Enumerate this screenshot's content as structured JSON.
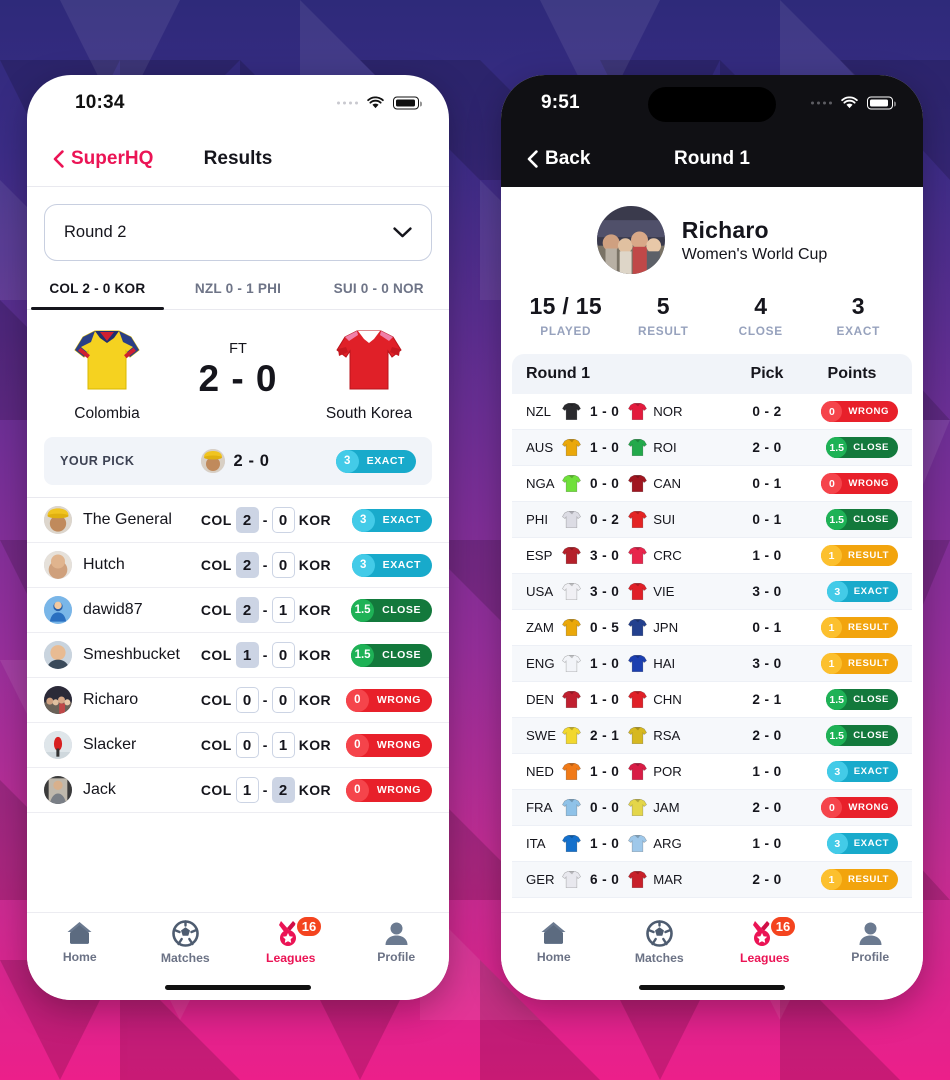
{
  "background": {
    "top_color": "#2e2a7a",
    "bottom_color": "#ec1f8a"
  },
  "left_phone": {
    "status": {
      "time": "10:34",
      "wifi_icon": "wifi-icon",
      "battery_icon": "battery-icon",
      "cellular_icon": "cellular-dots-icon"
    },
    "nav": {
      "back_label": "SuperHQ",
      "back_icon": "chevron-left-icon",
      "title": "Results",
      "accent": "#eb1455"
    },
    "round_select": {
      "value": "Round 2",
      "chevron_icon": "chevron-down-icon"
    },
    "match_tabs": [
      {
        "label": "COL 2 - 0 KOR",
        "active": true
      },
      {
        "label": "NZL 0 - 1 PHI",
        "active": false
      },
      {
        "label": "SUI 0 - 0 NOR",
        "active": false
      }
    ],
    "scoreboard": {
      "home": {
        "name": "Colombia",
        "shirt_icon": "shirt-colombia-icon",
        "shirt_color": "#f5d220"
      },
      "away": {
        "name": "South Korea",
        "shirt_icon": "shirt-south-korea-icon",
        "shirt_color": "#e02028"
      },
      "status": "FT",
      "score": "2 - 0"
    },
    "your_pick": {
      "label": "YOUR PICK",
      "avatar_icon": "avatar-the-general-icon",
      "score": "2 - 0",
      "pill": {
        "points": "3",
        "label": "EXACT",
        "kind": "exact"
      }
    },
    "picks": [
      {
        "name": "The General",
        "avatar_icon": "avatar-the-general-icon",
        "home_abbr": "COL",
        "home": "2",
        "away": "0",
        "away_abbr": "KOR",
        "pill": {
          "points": "3",
          "label": "EXACT",
          "kind": "exact"
        }
      },
      {
        "name": "Hutch",
        "avatar_icon": "avatar-hutch-icon",
        "home_abbr": "COL",
        "home": "2",
        "away": "0",
        "away_abbr": "KOR",
        "pill": {
          "points": "3",
          "label": "EXACT",
          "kind": "exact"
        }
      },
      {
        "name": "dawid87",
        "avatar_icon": "avatar-dawid87-icon",
        "home_abbr": "COL",
        "home": "2",
        "away": "1",
        "away_abbr": "KOR",
        "pill": {
          "points": "1.5",
          "label": "CLOSE",
          "kind": "close"
        }
      },
      {
        "name": "Smeshbucket",
        "avatar_icon": "avatar-smeshbucket-icon",
        "home_abbr": "COL",
        "home": "1",
        "away": "0",
        "away_abbr": "KOR",
        "pill": {
          "points": "1.5",
          "label": "CLOSE",
          "kind": "close"
        }
      },
      {
        "name": "Richaro",
        "avatar_icon": "avatar-richaro-icon",
        "home_abbr": "COL",
        "home": "0",
        "away": "0",
        "away_abbr": "KOR",
        "pill": {
          "points": "0",
          "label": "WRONG",
          "kind": "wrong"
        }
      },
      {
        "name": "Slacker",
        "avatar_icon": "avatar-slacker-icon",
        "home_abbr": "COL",
        "home": "0",
        "away": "1",
        "away_abbr": "KOR",
        "pill": {
          "points": "0",
          "label": "WRONG",
          "kind": "wrong"
        }
      },
      {
        "name": "Jack",
        "avatar_icon": "avatar-jack-icon",
        "home_abbr": "COL",
        "home": "1",
        "away": "2",
        "away_abbr": "KOR",
        "pill": {
          "points": "0",
          "label": "WRONG",
          "kind": "wrong"
        }
      }
    ]
  },
  "right_phone": {
    "status": {
      "time": "9:51",
      "wifi_icon": "wifi-icon",
      "battery_icon": "battery-icon",
      "cellular_icon": "cellular-dots-icon"
    },
    "nav": {
      "back_label": "Back",
      "back_icon": "chevron-left-icon",
      "title": "Round 1"
    },
    "profile": {
      "avatar_icon": "avatar-richaro-icon",
      "name": "Richaro",
      "league": "Women's World Cup"
    },
    "stats": [
      {
        "value": "15 / 15",
        "label": "PLAYED"
      },
      {
        "value": "5",
        "label": "RESULT"
      },
      {
        "value": "4",
        "label": "CLOSE"
      },
      {
        "value": "3",
        "label": "EXACT"
      }
    ],
    "table": {
      "headers": {
        "round": "Round 1",
        "pick": "Pick",
        "points": "Points"
      },
      "rows": [
        {
          "home_abbr": "NZL",
          "home_shirt": "shirt-nzl-icon",
          "home_color": "#2a2a2e",
          "score": "1 - 0",
          "away_shirt": "shirt-nor-icon",
          "away_color": "#e31b3d",
          "away_abbr": "NOR",
          "pick": "0 - 2",
          "pill": {
            "points": "0",
            "label": "WRONG",
            "kind": "wrong"
          }
        },
        {
          "home_abbr": "AUS",
          "home_shirt": "shirt-aus-icon",
          "home_color": "#eaa80a",
          "score": "1 - 0",
          "away_shirt": "shirt-roi-icon",
          "away_color": "#23a94b",
          "away_abbr": "ROI",
          "pick": "2 - 0",
          "pill": {
            "points": "1.5",
            "label": "CLOSE",
            "kind": "close"
          }
        },
        {
          "home_abbr": "NGA",
          "home_shirt": "shirt-nga-icon",
          "home_color": "#6fe03a",
          "score": "0 - 0",
          "away_shirt": "shirt-can-icon",
          "away_color": "#a01620",
          "away_abbr": "CAN",
          "pick": "0 - 1",
          "pill": {
            "points": "0",
            "label": "WRONG",
            "kind": "wrong"
          }
        },
        {
          "home_abbr": "PHI",
          "home_shirt": "shirt-phi-icon",
          "home_color": "#dcdce4",
          "score": "0 - 2",
          "away_shirt": "shirt-sui-icon",
          "away_color": "#e42424",
          "away_abbr": "SUI",
          "pick": "0 - 1",
          "pill": {
            "points": "1.5",
            "label": "CLOSE",
            "kind": "close"
          }
        },
        {
          "home_abbr": "ESP",
          "home_shirt": "shirt-esp-icon",
          "home_color": "#b5202a",
          "score": "3 - 0",
          "away_shirt": "shirt-crc-icon",
          "away_color": "#e8254c",
          "away_abbr": "CRC",
          "pick": "1 - 0",
          "pill": {
            "points": "1",
            "label": "RESULT",
            "kind": "result"
          }
        },
        {
          "home_abbr": "USA",
          "home_shirt": "shirt-usa-icon",
          "home_color": "#f0f0f4",
          "score": "3 - 0",
          "away_shirt": "shirt-vie-icon",
          "away_color": "#e02028",
          "away_abbr": "VIE",
          "pick": "3 - 0",
          "pill": {
            "points": "3",
            "label": "EXACT",
            "kind": "exact"
          }
        },
        {
          "home_abbr": "ZAM",
          "home_shirt": "shirt-zam-icon",
          "home_color": "#eaa80a",
          "score": "0 - 5",
          "away_shirt": "shirt-jpn-icon",
          "away_color": "#23408e",
          "away_abbr": "JPN",
          "pick": "0 - 1",
          "pill": {
            "points": "1",
            "label": "RESULT",
            "kind": "result"
          }
        },
        {
          "home_abbr": "ENG",
          "home_shirt": "shirt-eng-icon",
          "home_color": "#f2f4f8",
          "score": "1 - 0",
          "away_shirt": "shirt-hai-icon",
          "away_color": "#1c3fb0",
          "away_abbr": "HAI",
          "pick": "3 - 0",
          "pill": {
            "points": "1",
            "label": "RESULT",
            "kind": "result"
          }
        },
        {
          "home_abbr": "DEN",
          "home_shirt": "shirt-den-icon",
          "home_color": "#c02030",
          "score": "1 - 0",
          "away_shirt": "shirt-chn-icon",
          "away_color": "#e02028",
          "away_abbr": "CHN",
          "pick": "2 - 1",
          "pill": {
            "points": "1.5",
            "label": "CLOSE",
            "kind": "close"
          }
        },
        {
          "home_abbr": "SWE",
          "home_shirt": "shirt-swe-icon",
          "home_color": "#f2d82e",
          "score": "2 - 1",
          "away_shirt": "shirt-rsa-icon",
          "away_color": "#d6b820",
          "away_abbr": "RSA",
          "pick": "2 - 0",
          "pill": {
            "points": "1.5",
            "label": "CLOSE",
            "kind": "close"
          }
        },
        {
          "home_abbr": "NED",
          "home_shirt": "shirt-ned-icon",
          "home_color": "#f07a18",
          "score": "1 - 0",
          "away_shirt": "shirt-por-icon",
          "away_color": "#d81c45",
          "away_abbr": "POR",
          "pick": "1 - 0",
          "pill": {
            "points": "3",
            "label": "EXACT",
            "kind": "exact"
          }
        },
        {
          "home_abbr": "FRA",
          "home_shirt": "shirt-fra-icon",
          "home_color": "#8fc2e8",
          "score": "0 - 0",
          "away_shirt": "shirt-jam-icon",
          "away_color": "#e4d64a",
          "away_abbr": "JAM",
          "pick": "2 - 0",
          "pill": {
            "points": "0",
            "label": "WRONG",
            "kind": "wrong"
          }
        },
        {
          "home_abbr": "ITA",
          "home_shirt": "shirt-ita-icon",
          "home_color": "#1470cc",
          "score": "1 - 0",
          "away_shirt": "shirt-arg-icon",
          "away_color": "#9fc8ea",
          "away_abbr": "ARG",
          "pick": "1 - 0",
          "pill": {
            "points": "3",
            "label": "EXACT",
            "kind": "exact"
          }
        },
        {
          "home_abbr": "GER",
          "home_shirt": "shirt-ger-icon",
          "home_color": "#e8e8ee",
          "score": "6 - 0",
          "away_shirt": "shirt-mar-icon",
          "away_color": "#c8202a",
          "away_abbr": "MAR",
          "pick": "2 - 0",
          "pill": {
            "points": "1",
            "label": "RESULT",
            "kind": "result"
          }
        }
      ]
    }
  },
  "tabbar": {
    "items": [
      {
        "label": "Home",
        "icon": "home-icon",
        "active": false,
        "badge": null
      },
      {
        "label": "Matches",
        "icon": "ball-icon",
        "active": false,
        "badge": null
      },
      {
        "label": "Leagues",
        "icon": "medal-icon",
        "active": true,
        "badge": "16"
      },
      {
        "label": "Profile",
        "icon": "person-icon",
        "active": false,
        "badge": null
      }
    ],
    "active_color": "#eb1455",
    "badge_color": "#f4441f"
  }
}
